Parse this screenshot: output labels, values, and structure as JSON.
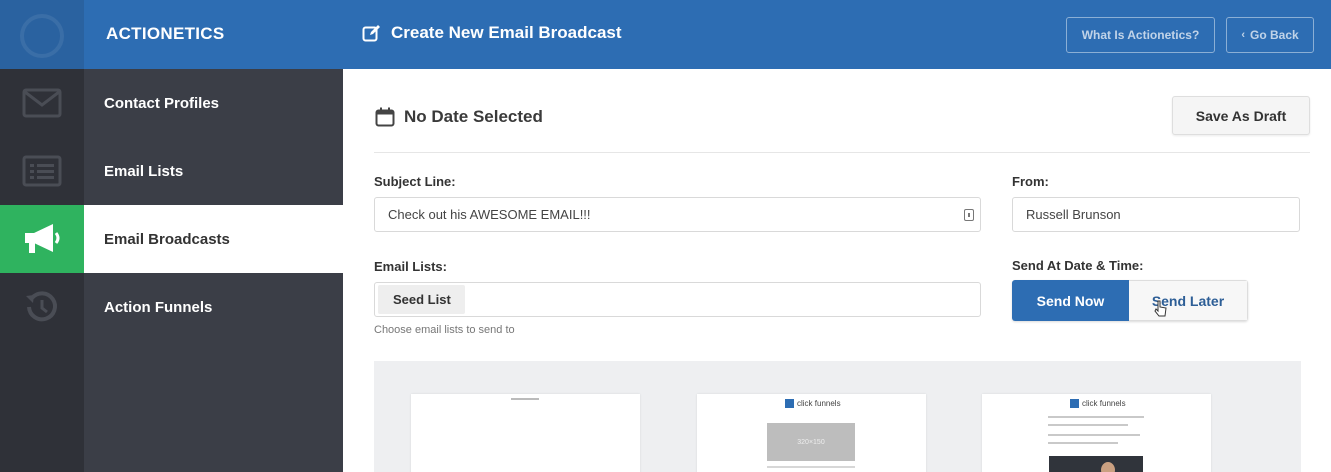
{
  "header": {
    "app_title": "ACTIONETICS",
    "page_title": "Create New Email Broadcast",
    "what_is_label": "What Is Actionetics?",
    "go_back_label": "Go Back"
  },
  "sidebar": {
    "items": [
      {
        "label": "Contact Profiles",
        "icon": "envelope-icon"
      },
      {
        "label": "Email Lists",
        "icon": "list-icon"
      },
      {
        "label": "Email Broadcasts",
        "icon": "megaphone-icon",
        "active": true
      },
      {
        "label": "Action Funnels",
        "icon": "history-icon"
      }
    ]
  },
  "main": {
    "date_text": "No Date Selected",
    "save_draft_label": "Save As Draft",
    "subject": {
      "label": "Subject Line:",
      "value": "Check out his AWESOME EMAIL!!!"
    },
    "from": {
      "label": "From:",
      "value": "Russell Brunson"
    },
    "email_lists": {
      "label": "Email Lists:",
      "selected_tag": "Seed List",
      "help": "Choose email lists to send to"
    },
    "send_at": {
      "label": "Send At Date & Time:",
      "options": [
        "Send Now",
        "Send Later"
      ],
      "selected": "Send Now"
    }
  },
  "templates": {
    "brand_text": "click funnels",
    "placeholder_text": "320×150"
  },
  "colors": {
    "header_blue": "#2d6db3",
    "sidebar_dark": "#3b3e47",
    "active_green": "#2fb35f"
  }
}
